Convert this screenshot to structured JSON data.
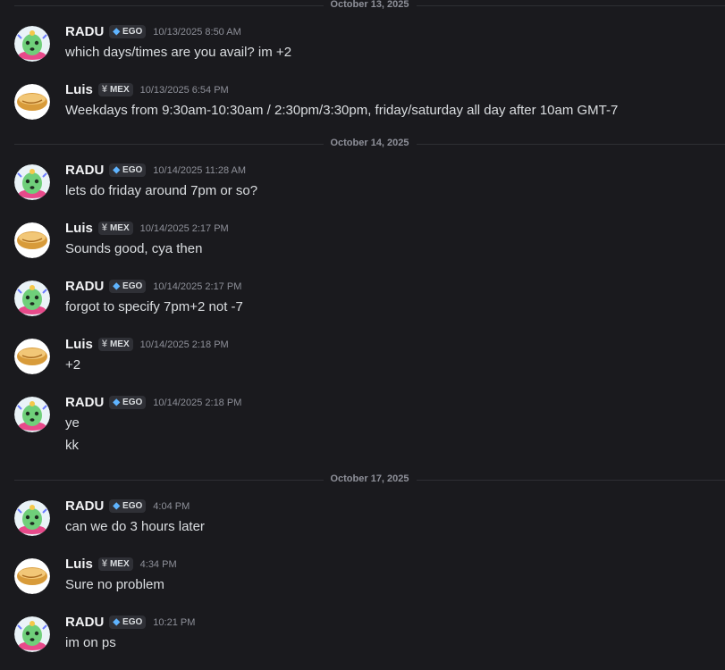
{
  "dividers": [
    {
      "label": "October 13, 2025"
    },
    {
      "label": "October 14, 2025"
    },
    {
      "label": "October 17, 2025"
    }
  ],
  "messages": [
    {
      "author": "RADU",
      "tag": "EGO",
      "time": "10/13/2025 8:50 AM",
      "lines": [
        "which days/times are you avail? im +2"
      ]
    },
    {
      "author": "Luis",
      "tag": "MEX",
      "time": "10/13/2025 6:54 PM",
      "lines": [
        "Weekdays from 9:30am-10:30am / 2:30pm/3:30pm, friday/saturday all day after 10am GMT-7"
      ]
    },
    {
      "author": "RADU",
      "tag": "EGO",
      "time": "10/14/2025 11:28 AM",
      "lines": [
        "lets do friday around 7pm or so?"
      ]
    },
    {
      "author": "Luis",
      "tag": "MEX",
      "time": "10/14/2025 2:17 PM",
      "lines": [
        "Sounds good, cya then"
      ]
    },
    {
      "author": "RADU",
      "tag": "EGO",
      "time": "10/14/2025 2:17 PM",
      "lines": [
        "forgot to specify 7pm+2 not -7"
      ]
    },
    {
      "author": "Luis",
      "tag": "MEX",
      "time": "10/14/2025 2:18 PM",
      "lines": [
        "+2"
      ]
    },
    {
      "author": "RADU",
      "tag": "EGO",
      "time": "10/14/2025 2:18 PM",
      "lines": [
        "ye",
        "kk"
      ]
    },
    {
      "author": "RADU",
      "tag": "EGO",
      "time": "4:04 PM",
      "lines": [
        "can we do 3 hours later"
      ]
    },
    {
      "author": "Luis",
      "tag": "MEX",
      "time": "4:34 PM",
      "lines": [
        "Sure no problem"
      ]
    },
    {
      "author": "RADU",
      "tag": "EGO",
      "time": "10:21 PM",
      "lines": [
        "im on ps"
      ]
    }
  ],
  "colors": {
    "background": "#1a1a1e",
    "text": "#dbdee1",
    "muted": "#8e9099",
    "ego_gem": "#5fb4ff"
  },
  "icons": {
    "radu_avatar": "cactus-avatar",
    "luis_avatar": "bread-avatar",
    "ego_tag_icon": "gem-icon",
    "mex_tag_icon": "yen-emblem-icon"
  }
}
